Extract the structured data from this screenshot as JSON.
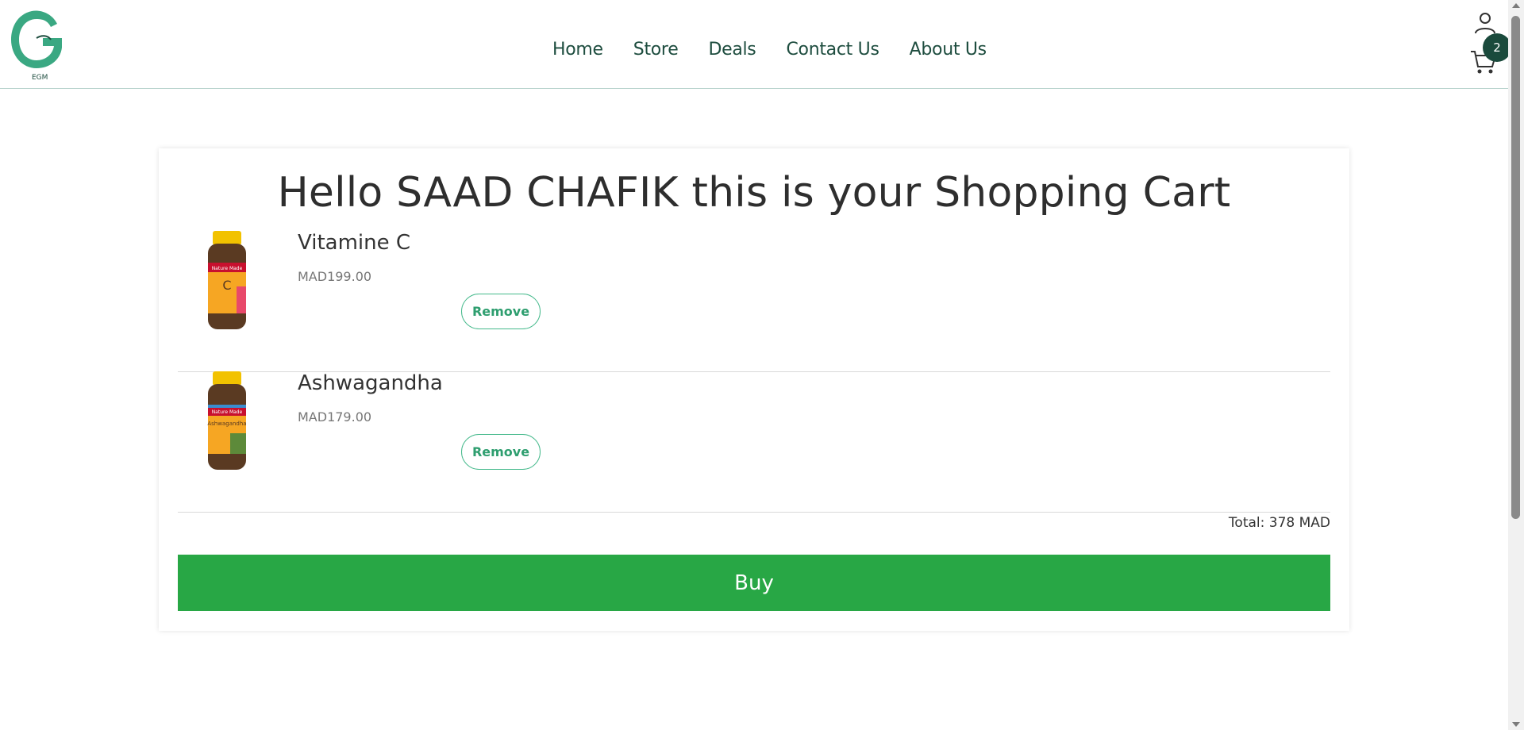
{
  "brand": {
    "logo_text": "EGM",
    "logo_letter": "G",
    "accent_color": "#3aa882"
  },
  "nav": {
    "items": [
      "Home",
      "Store",
      "Deals",
      "Contact Us",
      "About Us"
    ]
  },
  "header_icons": {
    "user": "user-icon",
    "cart": "cart-icon",
    "cart_count": "2"
  },
  "cart": {
    "title": "Hello SAAD CHAFIK this is your Shopping Cart",
    "items": [
      {
        "name": "Vitamine C",
        "price": "MAD199.00",
        "remove_label": "Remove",
        "bottle_label": "C",
        "bottle_brand": "Nature Made"
      },
      {
        "name": "Ashwagandha",
        "price": "MAD179.00",
        "remove_label": "Remove",
        "bottle_label": "Ashwagandha",
        "bottle_brand": "Nature Made"
      }
    ],
    "total": "Total: 378 MAD",
    "buy_label": "Buy",
    "buy_color": "#28a745"
  }
}
